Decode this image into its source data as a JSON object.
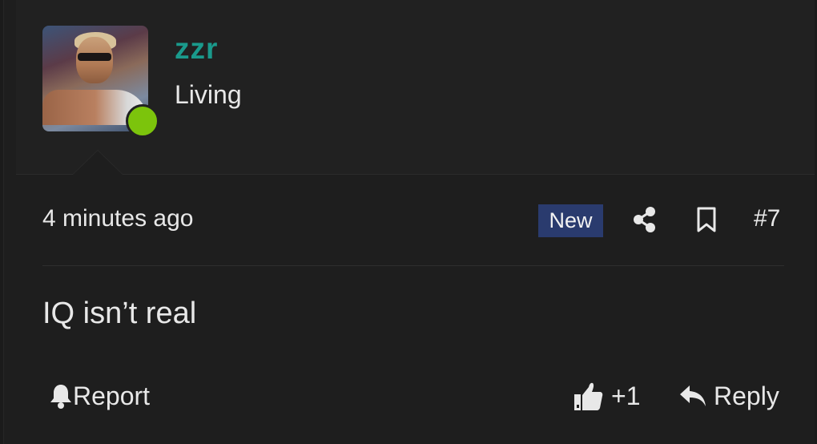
{
  "user": {
    "name": "zzr",
    "title": "Living",
    "status_color": "#7cc40c",
    "name_color": "#1a9a8c"
  },
  "meta": {
    "time": "4 minutes ago",
    "badge": "New",
    "post_number": "#7",
    "share_icon": "share-icon",
    "bookmark_icon": "bookmark-icon"
  },
  "message": {
    "text": "IQ isn’t real"
  },
  "actions": {
    "report_label": "Report",
    "like_count": "+1",
    "reply_label": "Reply"
  }
}
